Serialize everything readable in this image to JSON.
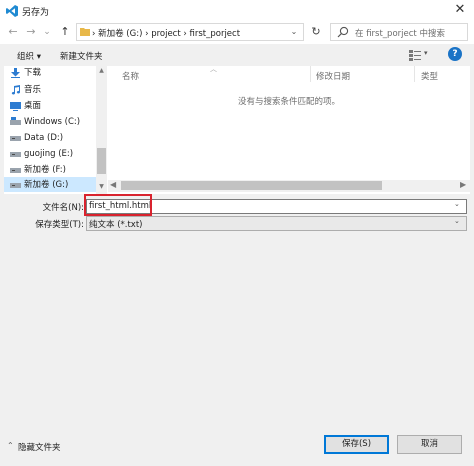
{
  "window": {
    "title": "另存为",
    "close_glyph": "✕"
  },
  "nav": {
    "back_glyph": "←",
    "forward_glyph": "→",
    "recent_glyph": "⌄",
    "up_glyph": "↑",
    "address": "› 新加卷 (G:)  ›  project  ›  first_porject",
    "address_drop": "⌄",
    "refresh_glyph": "↻",
    "search_placeholder": "在 first_porject 中搜索"
  },
  "toolbar": {
    "organize": "组织 ▾",
    "new_folder": "新建文件夹",
    "view_drop": "▾",
    "help": "?"
  },
  "sidebar": {
    "items": [
      {
        "label": "下载",
        "icon": "download-icon"
      },
      {
        "label": "音乐",
        "icon": "music-icon"
      },
      {
        "label": "桌面",
        "icon": "desktop-icon"
      },
      {
        "label": "Windows (C:)",
        "icon": "drive-icon"
      },
      {
        "label": "Data (D:)",
        "icon": "drive-icon"
      },
      {
        "label": "guojing (E:)",
        "icon": "drive-icon"
      },
      {
        "label": "新加卷 (F:)",
        "icon": "drive-icon"
      },
      {
        "label": "新加卷 (G:)",
        "icon": "drive-icon"
      }
    ]
  },
  "filelist": {
    "columns": [
      "名称",
      "修改日期",
      "类型"
    ],
    "empty_message": "没有与搜索条件匹配的项。"
  },
  "form": {
    "filename_label": "文件名(N):",
    "filename_value": "first_html.html",
    "filetype_label": "保存类型(T):",
    "filetype_value": "纯文本 (*.txt)"
  },
  "footer": {
    "hide_folders": "隐藏文件夹",
    "save": "保存(S)",
    "cancel": "取消"
  },
  "colors": {
    "accent": "#0078d7",
    "highlight_box": "#d9232e",
    "selected_bg": "#cce8ff"
  }
}
